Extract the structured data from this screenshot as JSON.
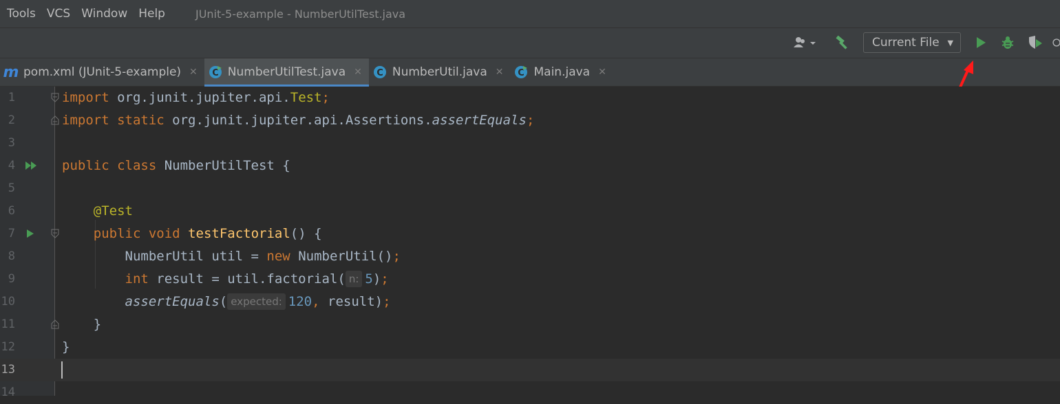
{
  "menubar": {
    "items": [
      "Tools",
      "VCS",
      "Window",
      "Help"
    ],
    "window_title": "JUnit-5-example - NumberUtilTest.java"
  },
  "toolbar": {
    "run_config": "Current File",
    "icons": [
      "user-icon",
      "build-hammer-icon",
      "run-icon",
      "debug-icon",
      "coverage-icon",
      "profile-icon"
    ]
  },
  "tabs": [
    {
      "label": "pom.xml (JUnit-5-example)",
      "icon": "maven-icon",
      "active": false
    },
    {
      "label": "NumberUtilTest.java",
      "icon": "java-class-test-icon",
      "active": true
    },
    {
      "label": "NumberUtil.java",
      "icon": "java-class-icon",
      "active": false
    },
    {
      "label": "Main.java",
      "icon": "java-class-main-icon",
      "active": false
    }
  ],
  "editor": {
    "line_numbers": [
      "1",
      "2",
      "3",
      "4",
      "5",
      "6",
      "7",
      "8",
      "9",
      "10",
      "11",
      "12",
      "13",
      "14"
    ],
    "code": {
      "l1_kw": "import",
      "l1_pkg": " org.junit.jupiter.api.",
      "l1_cls": "Test",
      "l1_semi": ";",
      "l2_kw": "import static",
      "l2_pkg": " org.junit.jupiter.api.Assertions.",
      "l2_fn": "assertEquals",
      "l2_semi": ";",
      "l4_kw": "public class",
      "l4_rest": " NumberUtilTest {",
      "l6_ann": "@Test",
      "l7_kw": "public void",
      "l7_fn": "testFactorial",
      "l7_rest": "() {",
      "l8_a": "NumberUtil util = ",
      "l8_kw": "new",
      "l8_b": " NumberUtil()",
      "l8_semi": ";",
      "l9_kw": "int",
      "l9_a": " result = util.factorial(",
      "l9_hint": "n:",
      "l9_num": "5",
      "l9_b": ")",
      "l9_semi": ";",
      "l10_fn": "assertEquals",
      "l10_a": "(",
      "l10_hint": "expected:",
      "l10_num": "120",
      "l10_comma": ",",
      "l10_b": " result)",
      "l10_semi": ";",
      "l11": "}",
      "l12": "}"
    }
  }
}
